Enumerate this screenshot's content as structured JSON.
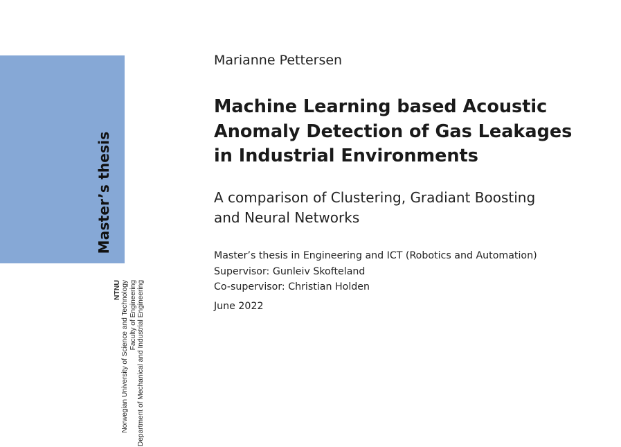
{
  "sidebar": {
    "band_label": "Master’s thesis",
    "institution_name": "NTNU",
    "institution_full": "Norwegian University of Science and Technology",
    "faculty": "Faculty of Engineering",
    "department": "Department of Mechanical and Industrial Engineering",
    "band_color": "#86a8d6"
  },
  "main": {
    "author": "Marianne Pettersen",
    "title_lines": [
      "Machine Learning based Acoustic",
      "Anomaly Detection of Gas Leakages",
      "in Industrial Environments"
    ],
    "subtitle_lines": [
      "A comparison of Clustering, Gradiant Boosting",
      "and Neural Networks"
    ],
    "thesis_description": "Master’s thesis in Engineering and ICT (Robotics and Automation)",
    "supervisor": "Supervisor: Gunleiv Skofteland",
    "co_supervisor": "Co-supervisor: Christian Holden",
    "date": "June 2022"
  }
}
